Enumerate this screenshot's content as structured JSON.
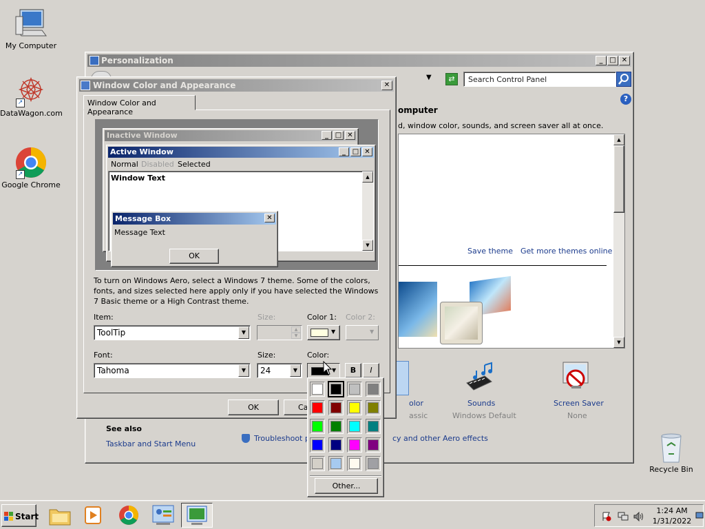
{
  "desktop": {
    "icons": [
      {
        "label": "My Computer"
      },
      {
        "label": "DataWagon.com"
      },
      {
        "label": "Google Chrome"
      },
      {
        "label": "Recycle Bin"
      }
    ]
  },
  "personalization": {
    "title": "Personalization",
    "search_placeholder": "Search Control Panel",
    "heading": "omputer",
    "subtext": "d, window color, sounds, and screen saver all at once.",
    "save_theme": "Save theme",
    "get_more_themes": "Get more themes online",
    "bottom_items": [
      {
        "label": "olor",
        "sub": "assic"
      },
      {
        "label": "Sounds",
        "sub": "Windows Default"
      },
      {
        "label": "Screen Saver",
        "sub": "None"
      }
    ],
    "see_also": {
      "title": "See also",
      "taskbar_link": "Taskbar and Start Menu",
      "troubleshoot_link": "Troubleshoot pr",
      "aero_link": "cy and other Aero effects"
    }
  },
  "dialog": {
    "title": "Window Color and Appearance",
    "tab_label": "Window Color and Appearance",
    "preview": {
      "inactive_title": "Inactive Window",
      "active_title": "Active Window",
      "menu": [
        "Normal",
        "Disabled",
        "Selected"
      ],
      "window_text": "Window Text",
      "msgbox_title": "Message Box",
      "msgbox_text": "Message Text",
      "msgbox_ok": "OK"
    },
    "info_text": "To turn on Windows Aero, select a Windows 7 theme.  Some of the colors, fonts, and sizes selected here apply only if you have selected the Windows 7 Basic theme or a High Contrast theme.",
    "labels": {
      "item": "Item:",
      "size": "Size:",
      "color1": "Color 1:",
      "color2": "Color 2:",
      "font": "Font:",
      "font_size": "Size:",
      "font_color": "Color:"
    },
    "item_value": "ToolTip",
    "font_value": "Tahoma",
    "font_size_value": "24",
    "bold_label": "B",
    "italic_label": "I",
    "ok_label": "OK",
    "cancel_label": "Ca",
    "color1_hex": "#ffffe1",
    "font_color_hex": "#000000"
  },
  "color_picker": {
    "colors": [
      "#ffffff",
      "#000000",
      "#c0c0c0",
      "#808080",
      "#ff0000",
      "#800000",
      "#ffff00",
      "#808000",
      "#00ff00",
      "#008000",
      "#00ffff",
      "#008080",
      "#0000ff",
      "#000080",
      "#ff00ff",
      "#800080",
      "#d4d0c8",
      "#a6caf0",
      "#fffbf0",
      "#a0a0a4"
    ],
    "selected_index": 1,
    "other_label": "Other..."
  },
  "taskbar": {
    "start_label": "Start",
    "time": "1:24 AM",
    "date": "1/31/2022"
  }
}
